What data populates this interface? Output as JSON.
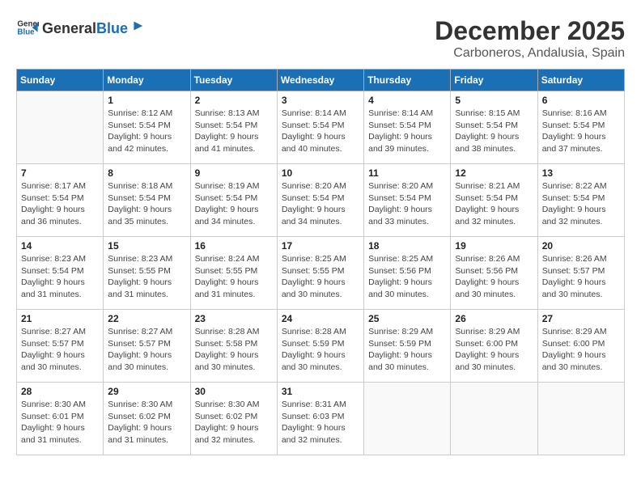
{
  "logo": {
    "general": "General",
    "blue": "Blue"
  },
  "title": "December 2025",
  "location": "Carboneros, Andalusia, Spain",
  "days_of_week": [
    "Sunday",
    "Monday",
    "Tuesday",
    "Wednesday",
    "Thursday",
    "Friday",
    "Saturday"
  ],
  "weeks": [
    [
      {
        "day": "",
        "info": ""
      },
      {
        "day": "1",
        "info": "Sunrise: 8:12 AM\nSunset: 5:54 PM\nDaylight: 9 hours and 42 minutes."
      },
      {
        "day": "2",
        "info": "Sunrise: 8:13 AM\nSunset: 5:54 PM\nDaylight: 9 hours and 41 minutes."
      },
      {
        "day": "3",
        "info": "Sunrise: 8:14 AM\nSunset: 5:54 PM\nDaylight: 9 hours and 40 minutes."
      },
      {
        "day": "4",
        "info": "Sunrise: 8:14 AM\nSunset: 5:54 PM\nDaylight: 9 hours and 39 minutes."
      },
      {
        "day": "5",
        "info": "Sunrise: 8:15 AM\nSunset: 5:54 PM\nDaylight: 9 hours and 38 minutes."
      },
      {
        "day": "6",
        "info": "Sunrise: 8:16 AM\nSunset: 5:54 PM\nDaylight: 9 hours and 37 minutes."
      }
    ],
    [
      {
        "day": "7",
        "info": "Sunrise: 8:17 AM\nSunset: 5:54 PM\nDaylight: 9 hours and 36 minutes."
      },
      {
        "day": "8",
        "info": "Sunrise: 8:18 AM\nSunset: 5:54 PM\nDaylight: 9 hours and 35 minutes."
      },
      {
        "day": "9",
        "info": "Sunrise: 8:19 AM\nSunset: 5:54 PM\nDaylight: 9 hours and 34 minutes."
      },
      {
        "day": "10",
        "info": "Sunrise: 8:20 AM\nSunset: 5:54 PM\nDaylight: 9 hours and 34 minutes."
      },
      {
        "day": "11",
        "info": "Sunrise: 8:20 AM\nSunset: 5:54 PM\nDaylight: 9 hours and 33 minutes."
      },
      {
        "day": "12",
        "info": "Sunrise: 8:21 AM\nSunset: 5:54 PM\nDaylight: 9 hours and 32 minutes."
      },
      {
        "day": "13",
        "info": "Sunrise: 8:22 AM\nSunset: 5:54 PM\nDaylight: 9 hours and 32 minutes."
      }
    ],
    [
      {
        "day": "14",
        "info": "Sunrise: 8:23 AM\nSunset: 5:54 PM\nDaylight: 9 hours and 31 minutes."
      },
      {
        "day": "15",
        "info": "Sunrise: 8:23 AM\nSunset: 5:55 PM\nDaylight: 9 hours and 31 minutes."
      },
      {
        "day": "16",
        "info": "Sunrise: 8:24 AM\nSunset: 5:55 PM\nDaylight: 9 hours and 31 minutes."
      },
      {
        "day": "17",
        "info": "Sunrise: 8:25 AM\nSunset: 5:55 PM\nDaylight: 9 hours and 30 minutes."
      },
      {
        "day": "18",
        "info": "Sunrise: 8:25 AM\nSunset: 5:56 PM\nDaylight: 9 hours and 30 minutes."
      },
      {
        "day": "19",
        "info": "Sunrise: 8:26 AM\nSunset: 5:56 PM\nDaylight: 9 hours and 30 minutes."
      },
      {
        "day": "20",
        "info": "Sunrise: 8:26 AM\nSunset: 5:57 PM\nDaylight: 9 hours and 30 minutes."
      }
    ],
    [
      {
        "day": "21",
        "info": "Sunrise: 8:27 AM\nSunset: 5:57 PM\nDaylight: 9 hours and 30 minutes."
      },
      {
        "day": "22",
        "info": "Sunrise: 8:27 AM\nSunset: 5:57 PM\nDaylight: 9 hours and 30 minutes."
      },
      {
        "day": "23",
        "info": "Sunrise: 8:28 AM\nSunset: 5:58 PM\nDaylight: 9 hours and 30 minutes."
      },
      {
        "day": "24",
        "info": "Sunrise: 8:28 AM\nSunset: 5:59 PM\nDaylight: 9 hours and 30 minutes."
      },
      {
        "day": "25",
        "info": "Sunrise: 8:29 AM\nSunset: 5:59 PM\nDaylight: 9 hours and 30 minutes."
      },
      {
        "day": "26",
        "info": "Sunrise: 8:29 AM\nSunset: 6:00 PM\nDaylight: 9 hours and 30 minutes."
      },
      {
        "day": "27",
        "info": "Sunrise: 8:29 AM\nSunset: 6:00 PM\nDaylight: 9 hours and 30 minutes."
      }
    ],
    [
      {
        "day": "28",
        "info": "Sunrise: 8:30 AM\nSunset: 6:01 PM\nDaylight: 9 hours and 31 minutes."
      },
      {
        "day": "29",
        "info": "Sunrise: 8:30 AM\nSunset: 6:02 PM\nDaylight: 9 hours and 31 minutes."
      },
      {
        "day": "30",
        "info": "Sunrise: 8:30 AM\nSunset: 6:02 PM\nDaylight: 9 hours and 32 minutes."
      },
      {
        "day": "31",
        "info": "Sunrise: 8:31 AM\nSunset: 6:03 PM\nDaylight: 9 hours and 32 minutes."
      },
      {
        "day": "",
        "info": ""
      },
      {
        "day": "",
        "info": ""
      },
      {
        "day": "",
        "info": ""
      }
    ]
  ]
}
